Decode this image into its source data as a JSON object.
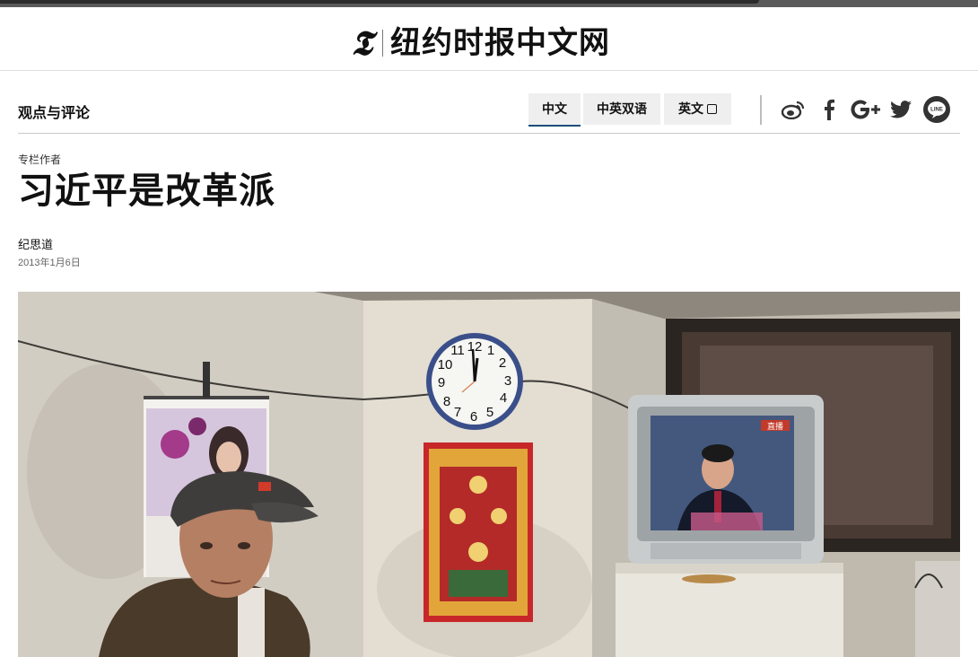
{
  "masthead": {
    "logo_glyph": "𝕿",
    "title": "纽约时报中文网"
  },
  "section": {
    "name": "观点与评论"
  },
  "language_tabs": [
    {
      "label": "中文",
      "active": true
    },
    {
      "label": "中英双语",
      "active": false
    },
    {
      "label": "英文",
      "active": false
    }
  ],
  "social_icons": [
    "weibo-icon",
    "facebook-icon",
    "google-plus-icon",
    "twitter-icon",
    "line-icon"
  ],
  "article": {
    "kicker": "专栏作者",
    "headline": "习近平是改革派",
    "byline": "纪思道",
    "date": "2013年1月6日"
  },
  "photo": {
    "description_icon": "article-photo",
    "tv_badge": "直播"
  },
  "colors": {
    "active_tab_underline": "#1c4f7e",
    "tab_bg": "#efefef",
    "line_icon_bg": "#333333"
  }
}
